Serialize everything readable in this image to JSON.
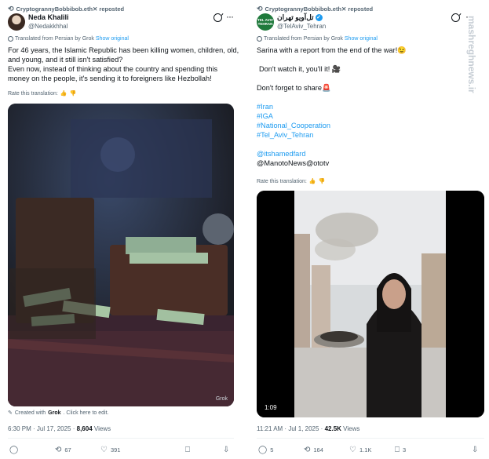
{
  "left": {
    "repost_label": "CryptogrannyBobbibob.eth✕ reposted",
    "name": "Neda Khalili",
    "handle": "@Nedakkhhal",
    "translated_label": "Translated from Persian by Grok",
    "show_original": "Show original",
    "text_lines": [
      "For 46 years, the Islamic Republic has been killing women, children, old,",
      "and young, and it still isn't satisfied?",
      "Even now, instead of thinking about the country and spending this",
      "money on the people, it's sending it to foreigners like Hezbollah!"
    ],
    "rate_label": "Rate this translation:",
    "media_badge": "Grok",
    "created_prefix": "Created with",
    "created_brand": "Grok",
    "created_suffix": ". Click here to edit.",
    "timestamp": "6:30 PM · Jul 17, 2025 ·",
    "views_count": "8,604",
    "views_label": "Views",
    "replies": "",
    "reposts": "67",
    "likes": "391",
    "bookmarks": ""
  },
  "right": {
    "repost_label": "CryptogrannyBobbibob.eth✕ reposted",
    "avatar_text": "TEL AVIV TEHRAN",
    "name": "تل‌آویو تهران",
    "handle": "@TelAviv_Tehran",
    "translated_label": "Translated from Persian by Grok",
    "show_original": "Show original",
    "line1": "Sarina with a report from the end of the war!😉",
    "line2": "Don't watch it, you'll it! 🎥",
    "line3": "Don't forget to share🚨",
    "hashtags": [
      "#Iran",
      "#IGA",
      "#National_Cooperation",
      "#Tel_Aviv_Tehran"
    ],
    "mention": "@itshamedfard",
    "source": "@ManotoNews@ototv",
    "rate_label": "Rate this translation:",
    "video_duration": "1:09",
    "timestamp": "11:21 AM · Jul 1, 2025 ·",
    "views_count": "42.5K",
    "views_label": "Views",
    "replies": "5",
    "reposts": "164",
    "likes": "1.1K",
    "bookmarks": "3"
  },
  "watermark": "mashreghnews.ir",
  "icons": {
    "repost": "repost-icon",
    "reply": "reply-icon",
    "like": "heart-icon",
    "bookmark": "bookmark-icon",
    "share": "share-icon",
    "more": "more-icon",
    "grok": "grok-icon"
  },
  "colors": {
    "link": "#1d9bf0",
    "secondary_text": "#536471",
    "primary_text": "#0f1419",
    "verified": "#1d9bf0",
    "alert": "#e0245e"
  }
}
